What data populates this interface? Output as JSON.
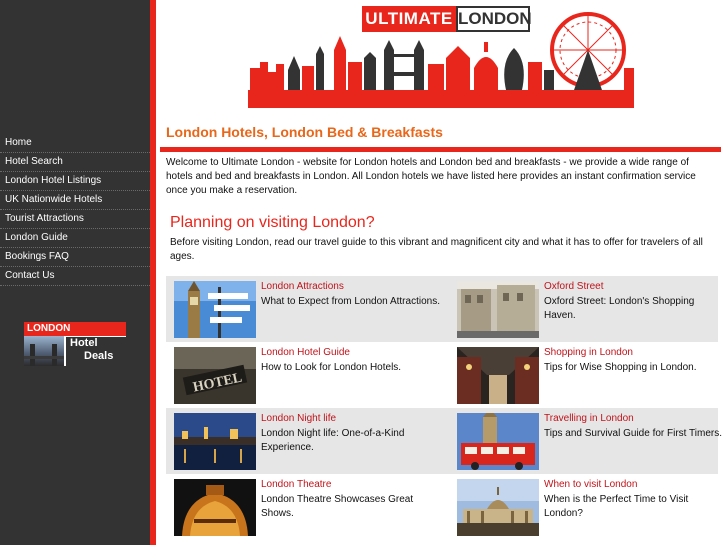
{
  "logo": {
    "word1": "ULTIMATE",
    "word2": "LONDON"
  },
  "sidebar": {
    "items": [
      {
        "label": "Home"
      },
      {
        "label": "Hotel Search"
      },
      {
        "label": "London Hotel Listings"
      },
      {
        "label": "UK Nationwide Hotels"
      },
      {
        "label": "Tourist Attractions"
      },
      {
        "label": "London Guide"
      },
      {
        "label": "Bookings FAQ"
      },
      {
        "label": "Contact Us"
      }
    ],
    "banner": {
      "top": "LONDON",
      "line1": "Hotel",
      "line2": "Deals"
    }
  },
  "main": {
    "title": "London Hotels, London Bed & Breakfasts",
    "intro": "Welcome to Ultimate London - website for London hotels and London bed and breakfasts - we provide a wide range of hotels and bed and breakfasts in London. All London hotels we have listed here provides an instant confirmation service once you make a reservation.",
    "plan_heading": "Planning on visiting London?",
    "plan_text": "Before visiting London, read our travel guide to this vibrant and magnificent city and what it has to offer  for travelers of all ages."
  },
  "grid": [
    {
      "title": "London Attractions",
      "desc": "What to Expect from London Attractions."
    },
    {
      "title": "Oxford Street",
      "desc": "Oxford Street: London's Shopping Haven."
    },
    {
      "title": "London Hotel Guide",
      "desc": "How to Look for London Hotels."
    },
    {
      "title": "Shopping in London",
      "desc": "Tips for Wise Shopping in London."
    },
    {
      "title": "London Night life",
      "desc": "London Night life: One-of-a-Kind Experience."
    },
    {
      "title": "Travelling in London",
      "desc": "Tips and Survival Guide for First Timers."
    },
    {
      "title": "London Theatre",
      "desc": "London Theatre Showcases Great Shows."
    },
    {
      "title": "When to visit London",
      "desc": "When is the Perfect Time to Visit London?"
    }
  ],
  "colors": {
    "accent": "#e8261c",
    "title": "#e8671a",
    "link": "#c0141b",
    "sidebar": "#333333"
  }
}
